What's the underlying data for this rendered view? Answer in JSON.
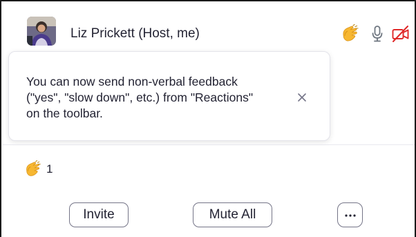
{
  "participant": {
    "name": "Liz Prickett (Host, me)",
    "reaction_icon": "clapping-hands-icon",
    "mic_icon": "microphone-icon",
    "video_icon": "video-off-icon"
  },
  "tooltip": {
    "lines": [
      "You can now send non-verbal feedback",
      "(\"yes\", \"slow down\", etc.) from \"Reactions\"",
      "on the toolbar."
    ],
    "close_icon": "close-icon"
  },
  "reactions": {
    "icon": "clapping-hands-icon",
    "count": "1"
  },
  "footer": {
    "invite_label": "Invite",
    "mute_all_label": "Mute All",
    "more_icon": "more-options-icon"
  },
  "colors": {
    "text": "#232333",
    "muted_icon": "#e02828",
    "clap_yellow": "#f7b731",
    "border": "#747487"
  }
}
